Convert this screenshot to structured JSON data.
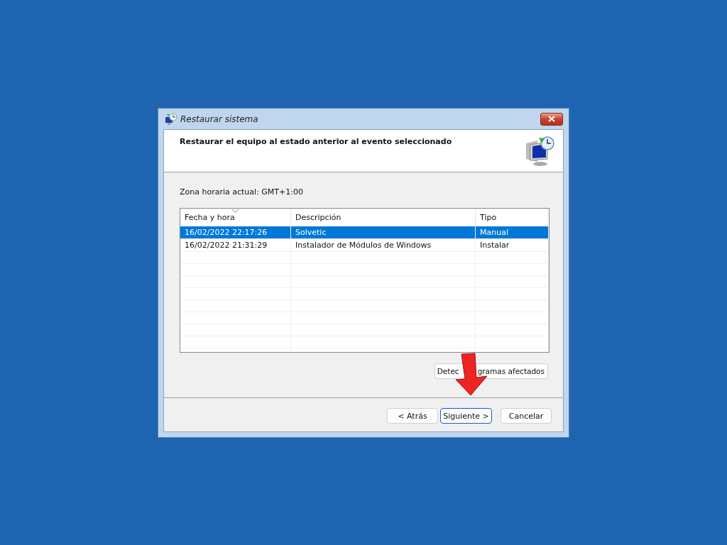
{
  "window": {
    "title": "Restaurar sistema"
  },
  "header": {
    "heading": "Restaurar el equipo al estado anterior al evento seleccionado"
  },
  "timezone_label": "Zona horaria actual: GMT+1:00",
  "table": {
    "columns": [
      {
        "label": "Fecha y hora",
        "sorted": true
      },
      {
        "label": "Descripción",
        "sorted": false
      },
      {
        "label": "Tipo",
        "sorted": false
      }
    ],
    "rows": [
      {
        "cells": [
          "16/02/2022 22:17:26",
          "Solvetic",
          "Manual"
        ],
        "selected": true
      },
      {
        "cells": [
          "16/02/2022 21:31:29",
          "Instalador de Módulos de Windows",
          "Instalar"
        ],
        "selected": false
      }
    ]
  },
  "detect_button": {
    "label_parts": [
      "Detec",
      "gramas afectados"
    ]
  },
  "buttons": [
    {
      "label": "< Atrás",
      "default": false
    },
    {
      "label": "Siguiente >",
      "default": true
    },
    {
      "label": "Cancelar",
      "default": false
    }
  ]
}
